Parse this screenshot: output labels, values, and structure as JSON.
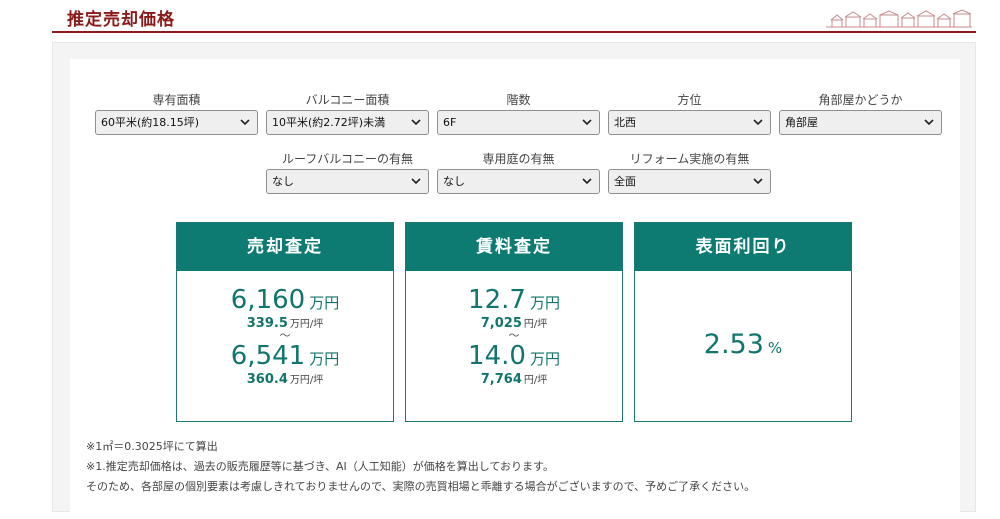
{
  "header": {
    "title": "推定売却価格"
  },
  "filters": {
    "row1": [
      {
        "label": "専有面積",
        "value": "60平米(約18.15坪)"
      },
      {
        "label": "バルコニー面積",
        "value": "10平米(約2.72坪)未満"
      },
      {
        "label": "階数",
        "value": "6F"
      },
      {
        "label": "方位",
        "value": "北西"
      },
      {
        "label": "角部屋かどうか",
        "value": "角部屋"
      }
    ],
    "row2": [
      {
        "label": "ルーフバルコニーの有無",
        "value": "なし"
      },
      {
        "label": "専用庭の有無",
        "value": "なし"
      },
      {
        "label": "リフォーム実施の有無",
        "value": "全面"
      }
    ]
  },
  "cards": {
    "sale": {
      "title": "売却査定",
      "low": "6,160",
      "low_unit": "万円",
      "low_per": "339.5",
      "low_per_unit": "万円/坪",
      "tilde": "～",
      "high": "6,541",
      "high_unit": "万円",
      "high_per": "360.4",
      "high_per_unit": "万円/坪"
    },
    "rent": {
      "title": "賃料査定",
      "low": "12.7",
      "low_unit": "万円",
      "low_per": "7,025",
      "low_per_unit": "円/坪",
      "tilde": "～",
      "high": "14.0",
      "high_unit": "万円",
      "high_per": "7,764",
      "high_per_unit": "円/坪"
    },
    "yield": {
      "title": "表面利回り",
      "value": "2.53",
      "unit": "%"
    }
  },
  "notes": [
    "※1㎡＝0.3025坪にて算出",
    "※1.推定売却価格は、過去の販売履歴等に基づき、AI（人工知能）が価格を算出しております。",
    "そのため、各部屋の個別要素は考慮しきれておりませんので、実際の売買相場と乖離する場合がございますので、予めご了承ください。"
  ],
  "colors": {
    "brand": "#8b1a1a",
    "accent": "#0e7b73"
  }
}
